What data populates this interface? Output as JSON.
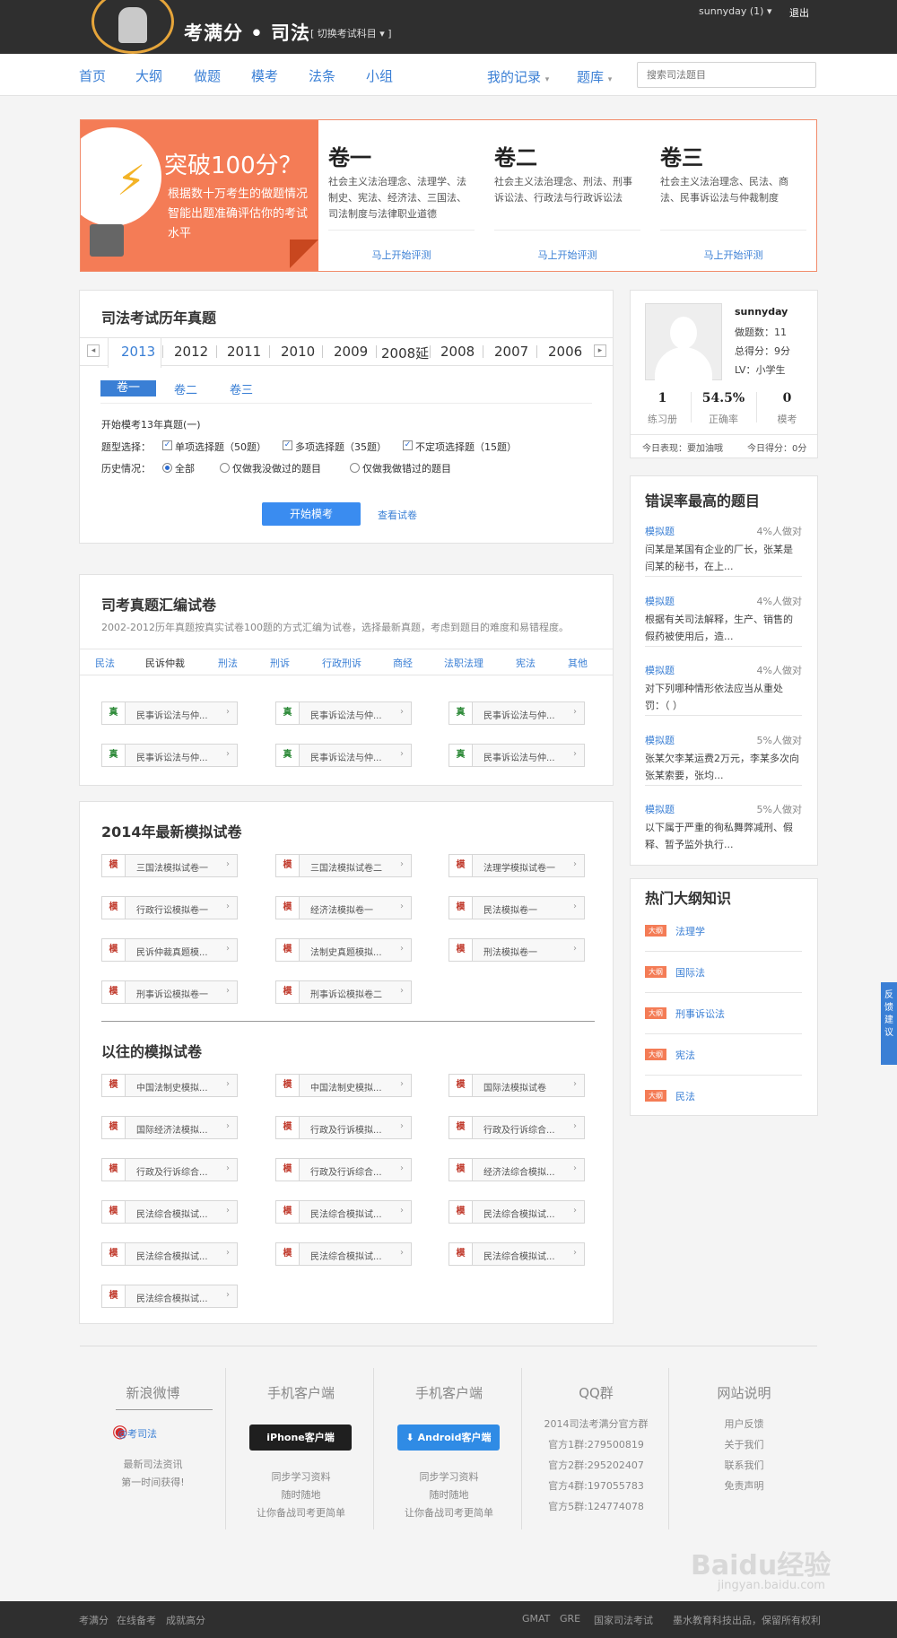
{
  "header": {
    "brand": "考满分",
    "brand_sub": "司法",
    "switch": "[ 切换考试科目 ▾ ]",
    "user": "sunnyday  (1)  ▾",
    "logout": "退出"
  },
  "nav": {
    "items": [
      "首页",
      "大纲",
      "做题",
      "模考",
      "法条",
      "小组"
    ],
    "my_record": "我的记录",
    "bank": "题库",
    "search_placeholder": "搜索司法题目"
  },
  "banner": {
    "title": "突破100分？",
    "text": "根据数十万考生的做题情况智能出题准确评估你的考试水平",
    "volumes": [
      {
        "title": "卷一",
        "desc": "社会主义法治理念、法理学、法制史、宪法、经济法、三国法、司法制度与法律职业道德",
        "link": "马上开始评测"
      },
      {
        "title": "卷二",
        "desc": "社会主义法治理念、刑法、刑事诉讼法、行政法与行政诉讼法",
        "link": "马上开始评测"
      },
      {
        "title": "卷三",
        "desc": "社会主义法治理念、民法、商法、民事诉讼法与仲裁制度",
        "link": "马上开始评测"
      }
    ]
  },
  "history": {
    "title": "司法考试历年真题",
    "years": [
      "2013",
      "2012",
      "2011",
      "2010",
      "2009",
      "2008延",
      "2008",
      "2007",
      "2006"
    ],
    "vol_tabs": [
      "卷一",
      "卷二",
      "卷三"
    ],
    "start_label": "开始模考13年真题(一)",
    "type_label": "题型选择：",
    "types": [
      "单项选择题（50题）",
      "多项选择题（35题）",
      "不定项选择题（15题）"
    ],
    "history_label": "历史情况：",
    "history_opts": [
      "全部",
      "仅做我没做过的题目",
      "仅做我做错过的题目"
    ],
    "start_btn": "开始模考",
    "view_link": "查看试卷"
  },
  "collection": {
    "title": "司考真题汇编试卷",
    "desc": "2002-2012历年真题按真实试卷100题的方式汇编为试卷，选择最新真题，考虑到题目的难度和易错程度。",
    "tabs": [
      "民法",
      "民诉仲裁",
      "刑法",
      "刑诉",
      "行政刑诉",
      "商经",
      "法职法理",
      "宪法",
      "其他"
    ],
    "tag": "真",
    "papers": [
      "民事诉讼法与仲...",
      "民事诉讼法与仲...",
      "民事诉讼法与仲...",
      "民事诉讼法与仲...",
      "民事诉讼法与仲...",
      "民事诉讼法与仲..."
    ]
  },
  "mock": {
    "title": "2014年最新模拟试卷",
    "tag": "模",
    "papers": [
      "三国法模拟试卷一",
      "三国法模拟试卷二",
      "法理学模拟试卷一",
      "行政行讼模拟卷一",
      "经济法模拟卷一",
      "民法模拟卷一",
      "民诉仲裁真题模...",
      "法制史真题模拟...",
      "刑法模拟卷一",
      "刑事诉讼模拟卷一",
      "刑事诉讼模拟卷二"
    ],
    "old_title": "以往的模拟试卷",
    "old_papers": [
      "中国法制史模拟...",
      "中国法制史模拟...",
      "国际法模拟试卷",
      "国际经济法模拟...",
      "行政及行诉模拟...",
      "行政及行诉综合...",
      "行政及行诉综合...",
      "行政及行诉综合...",
      "经济法综合模拟...",
      "民法综合模拟试...",
      "民法综合模拟试...",
      "民法综合模拟试...",
      "民法综合模拟试...",
      "民法综合模拟试...",
      "民法综合模拟试...",
      "民法综合模拟试..."
    ]
  },
  "profile": {
    "name": "sunnyday",
    "done": "做题数：11",
    "score": "总得分：9分",
    "level": "LV：小学生",
    "stats": [
      {
        "n": "1",
        "l": "练习册"
      },
      {
        "n": "54.5%",
        "l": "正确率"
      },
      {
        "n": "0",
        "l": "模考"
      }
    ],
    "today1": "今日表现：要加油哦",
    "today2": "今日得分：0分"
  },
  "errors": {
    "title": "错误率最高的题目",
    "items": [
      {
        "tag": "模拟题",
        "rate": "4%人做对",
        "text": "闫某是某国有企业的厂长，张某是闫某的秘书，在上..."
      },
      {
        "tag": "模拟题",
        "rate": "4%人做对",
        "text": "根据有关司法解释，生产、销售的假药被使用后，造..."
      },
      {
        "tag": "模拟题",
        "rate": "4%人做对",
        "text": "对下列哪种情形依法应当从重处罚：（ ）"
      },
      {
        "tag": "模拟题",
        "rate": "5%人做对",
        "text": "张某欠李某运费2万元，李某多次向张某索要，张均..."
      },
      {
        "tag": "模拟题",
        "rate": "5%人做对",
        "text": "以下属于严重的徇私舞弊减刑、假释、暂予监外执行..."
      }
    ]
  },
  "hot": {
    "title": "热门大纲知识",
    "tag": "大纲",
    "items": [
      "法理学",
      "国际法",
      "刑事诉讼法",
      "宪法",
      "民法"
    ]
  },
  "footer": {
    "weibo": {
      "title": "新浪微博",
      "handle": "@考司法",
      "l1": "最新司法资讯",
      "l2": "第一时间获得!"
    },
    "iphone": {
      "title": "手机客户端",
      "btn": "iPhone客户端",
      "l1": "同步学习资料",
      "l2": "随时随地",
      "l3": "让你备战司考更简单"
    },
    "android": {
      "title": "手机客户端",
      "btn": "Android客户端",
      "l1": "同步学习资料",
      "l2": "随时随地",
      "l3": "让你备战司考更简单"
    },
    "qq": {
      "title": "QQ群",
      "lines": [
        "2014司法考满分官方群",
        "官方1群:279500819",
        "官方2群:295202407",
        "官方4群:197055783",
        "官方5群:124774078"
      ]
    },
    "site": {
      "title": "网站说明",
      "lines": [
        "用户反馈",
        "关于我们",
        "联系我们",
        "免责声明"
      ]
    }
  },
  "bottom": {
    "left": [
      "考满分",
      "在线备考",
      "成就高分"
    ],
    "right": [
      "GMAT",
      "GRE",
      "国家司法考试",
      "墨水教育科技出品，保留所有权利"
    ]
  },
  "feedback": "反馈建议",
  "watermark": {
    "brand": "Baidu经验",
    "url": "jingyan.baidu.com"
  }
}
